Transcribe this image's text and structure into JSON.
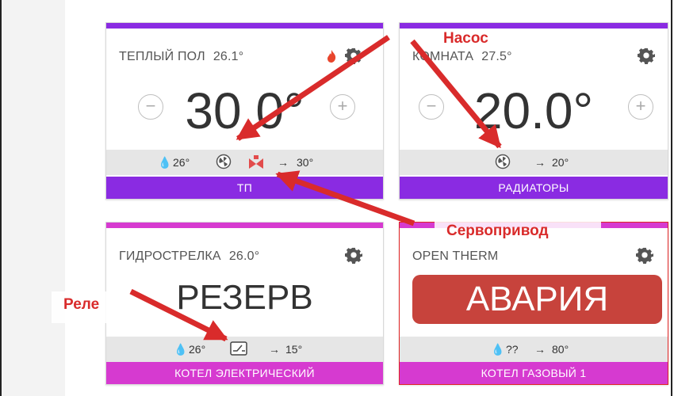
{
  "colors": {
    "purple": "#8a2be2",
    "magenta": "#d63ad0",
    "alarm_red": "#c7433c",
    "annotation_red": "#d92b2b",
    "flame": "#e8452c"
  },
  "cards": [
    {
      "title": "ТЕПЛЫЙ ПОЛ",
      "current_temp": "26.1°",
      "setpoint": "30.0°",
      "info": [
        "26°",
        "30°"
      ],
      "bottom_label": "ТП",
      "icons": [
        "flame-icon",
        "gear-icon",
        "minus-icon",
        "plus-icon",
        "drop-icon",
        "pump-icon",
        "servo-valve-icon",
        "arrow-right-icon"
      ]
    },
    {
      "title": "КОМНАТА",
      "current_temp": "27.5°",
      "setpoint": "20.0°",
      "info": [
        "20°"
      ],
      "bottom_label": "РАДИАТОРЫ",
      "icons": [
        "gear-icon",
        "minus-icon",
        "plus-icon",
        "pump-icon",
        "arrow-right-icon"
      ]
    },
    {
      "title": "ГИДРОСТРЕЛКА",
      "current_temp": "26.0°",
      "status": "РЕЗЕРВ",
      "info": [
        "26°",
        "15°"
      ],
      "bottom_label": "КОТЕЛ ЭЛЕКТРИЧЕСКИЙ",
      "icons": [
        "gear-icon",
        "drop-icon",
        "relay-icon",
        "arrow-right-icon"
      ]
    },
    {
      "title": "OPEN THERM",
      "status": "АВАРИЯ",
      "info": [
        "??",
        "80°"
      ],
      "bottom_label": "КОТЕЛ ГАЗОВЫЙ 1",
      "icons": [
        "gear-icon",
        "drop-icon",
        "arrow-right-icon"
      ]
    }
  ],
  "annotations": {
    "pump": "Насос",
    "servo": "Сервопривод",
    "relay": "Реле"
  }
}
